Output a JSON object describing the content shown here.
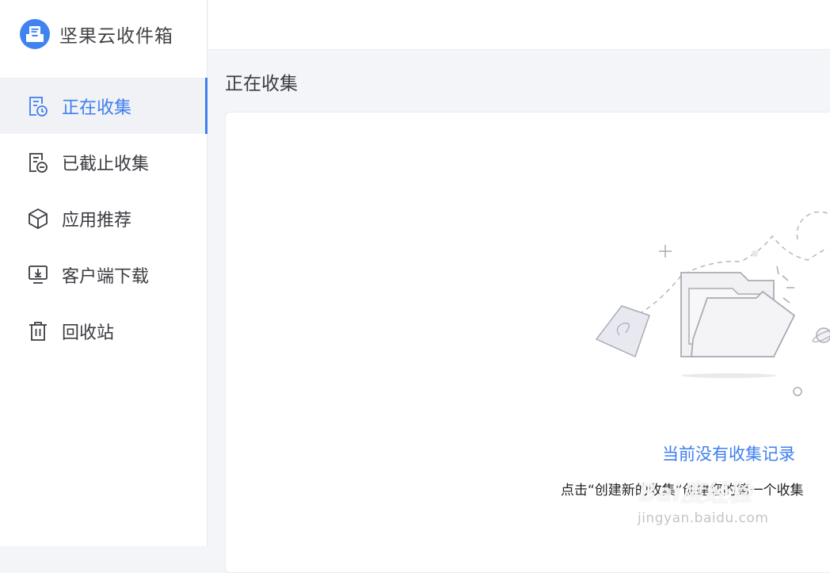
{
  "app": {
    "title": "坚果云收件箱"
  },
  "sidebar": {
    "items": [
      {
        "label": "正在收集",
        "icon": "collecting-icon",
        "active": true
      },
      {
        "label": "已截止收集",
        "icon": "closed-collection-icon",
        "active": false
      },
      {
        "label": "应用推荐",
        "icon": "cube-icon",
        "active": false
      },
      {
        "label": "客户端下载",
        "icon": "download-icon",
        "active": false
      },
      {
        "label": "回收站",
        "icon": "trash-icon",
        "active": false
      }
    ]
  },
  "main": {
    "title": "正在收集",
    "empty_state": {
      "title": "当前没有收集记录",
      "description": "点击“创建新的收集”创建您的第一个收集"
    }
  },
  "watermark": {
    "text": "Bai度经验",
    "url": "jingyan.baidu.com"
  },
  "colors": {
    "accent": "#3f7ff0",
    "logo": "#3f83f1",
    "background": "#f3f5f8"
  }
}
